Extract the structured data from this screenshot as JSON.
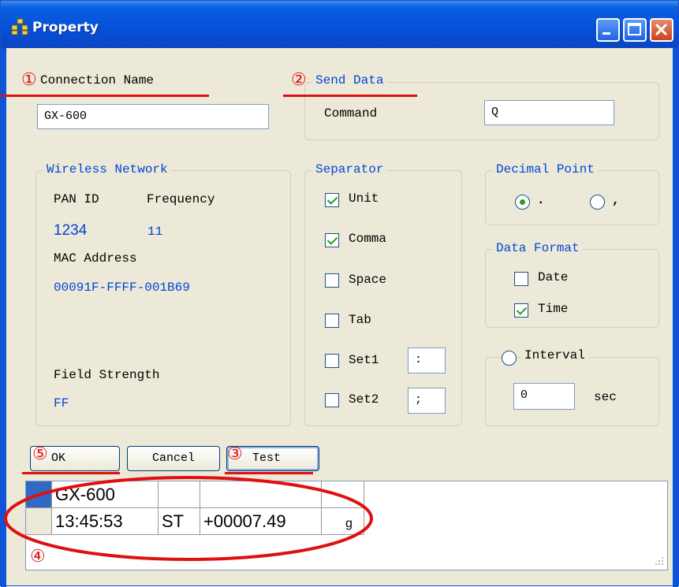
{
  "window": {
    "title": "Property"
  },
  "connection": {
    "label": "Connection Name",
    "value": "GX-600"
  },
  "send_data": {
    "legend": "Send Data",
    "command_label": "Command",
    "command_value": "Q"
  },
  "wireless": {
    "legend": "Wireless Network",
    "pan_id_label": "PAN ID",
    "pan_id_value": "1234",
    "frequency_label": "Frequency",
    "frequency_value": "11",
    "mac_label": "MAC Address",
    "mac_value": "00091F-FFFF-001B69",
    "field_strength_label": "Field Strength",
    "field_strength_value": "FF"
  },
  "separator": {
    "legend": "Separator",
    "unit": {
      "label": "Unit",
      "checked": true
    },
    "comma": {
      "label": "Comma",
      "checked": true
    },
    "space": {
      "label": "Space",
      "checked": false
    },
    "tab": {
      "label": "Tab",
      "checked": false
    },
    "set1": {
      "label": "Set1",
      "checked": false,
      "value": ":"
    },
    "set2": {
      "label": "Set2",
      "checked": false,
      "value": ";"
    }
  },
  "decimal_point": {
    "legend": "Decimal Point",
    "options": [
      ".",
      ","
    ],
    "selected": "."
  },
  "data_format": {
    "legend": "Data Format",
    "date": {
      "label": "Date",
      "checked": false
    },
    "time": {
      "label": "Time",
      "checked": true
    }
  },
  "interval": {
    "label": "Interval",
    "selected": false,
    "value": "0",
    "unit": "sec"
  },
  "buttons": {
    "ok": "OK",
    "cancel": "Cancel",
    "test": "Test"
  },
  "grid": {
    "row1": [
      "GX-600",
      "",
      "",
      ""
    ],
    "row2": [
      "13:45:53",
      "ST",
      "+00007.49",
      "g"
    ]
  },
  "annotations": {
    "m1": "①",
    "m2": "②",
    "m3": "③",
    "m4": "④",
    "m5": "⑤",
    "color": "#e01010"
  },
  "colors": {
    "accent_blue": "#0046d5",
    "titlebar": "#0650d8",
    "check_green": "#21a121"
  }
}
